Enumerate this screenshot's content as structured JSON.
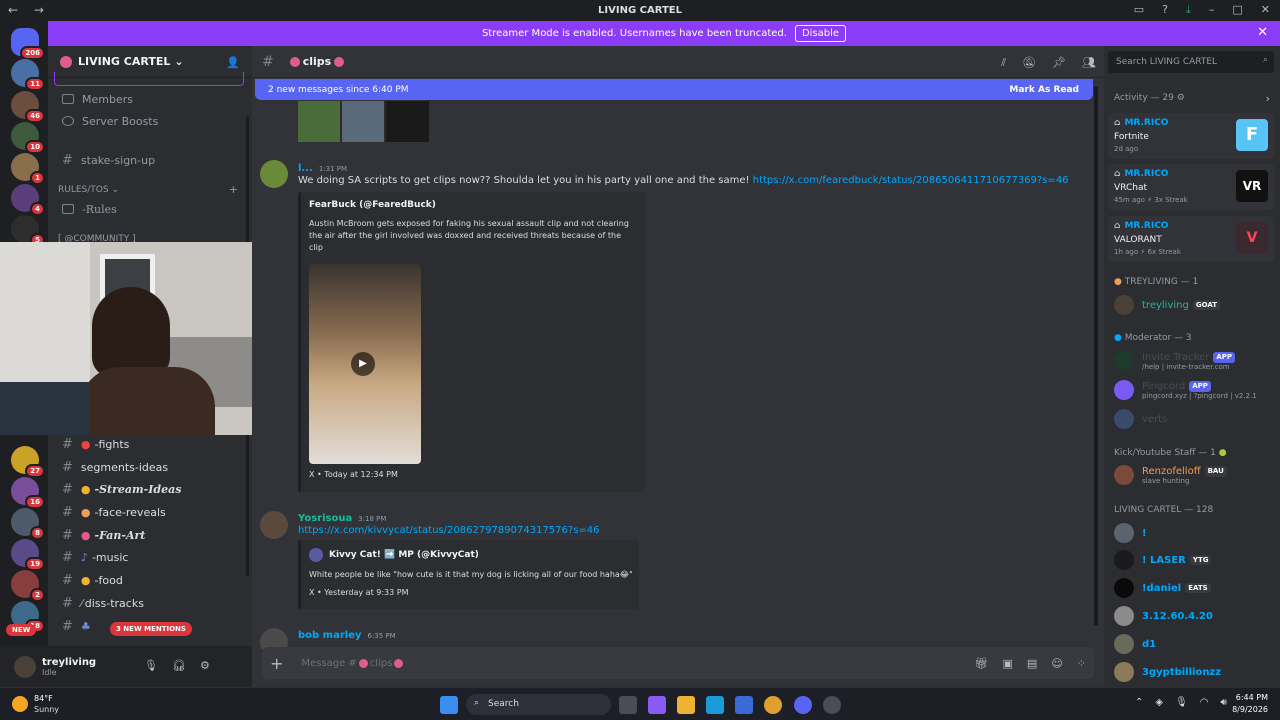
{
  "window": {
    "title": "LIVING CARTEL"
  },
  "banner": {
    "text": "Streamer Mode is enabled. Usernames have been truncated.",
    "button": "Disable"
  },
  "servers": {
    "home_badge": "206",
    "badges": [
      "11",
      "46",
      "10",
      "1",
      "4",
      "5",
      "27",
      "16",
      "8",
      "19",
      "2",
      "18"
    ],
    "new_label": "NEW"
  },
  "sidebar": {
    "server_name": "LIVING CARTEL",
    "items": [
      {
        "label": "Members"
      },
      {
        "label": "Server Boosts"
      }
    ],
    "channels_top": [
      {
        "label": "stake-sign-up"
      }
    ],
    "category_rules": "RULES/TOS",
    "rules_channel": "-Rules",
    "category_community": "[ @COMMUNITY ]",
    "channels": [
      {
        "label": "-fights"
      },
      {
        "label": "segments-ideas"
      },
      {
        "label": "-Stream-Ideas"
      },
      {
        "label": "-face-reveals"
      },
      {
        "label": "-Fan-Art"
      },
      {
        "label": "-music"
      },
      {
        "label": "-food"
      },
      {
        "label": "diss-tracks"
      }
    ],
    "mentions": "3 NEW MENTIONS"
  },
  "user": {
    "name": "treyliving",
    "status": "Idle"
  },
  "chat": {
    "channel": "clips",
    "new_messages": "2 new messages since 6:40 PM",
    "mark_read": "Mark As Read",
    "messages": [
      {
        "author": "l...",
        "time": "1:31 PM",
        "text": "We doing SA scripts to get clips now?? Shoulda let you in his party yall one and the same!",
        "link": "https://x.com/fearedbuck/status/2086506411710677369?s=46",
        "embed": {
          "author": "FearBuck (@FearedBuck)",
          "text": "Austin McBroom gets exposed for faking his sexual assault clip and not clearing the air after the girl involved was doxxed and received threats because of the clip",
          "footer": "X • Today at 12:34 PM"
        }
      },
      {
        "author": "Yosrisoua",
        "time": "3:18 PM",
        "link": "https://x.com/kivvycat/status/2086279789074317576?s=46",
        "embed": {
          "author": "Kivvy Cat! ➡️ MP (@KivvyCat)",
          "text": "White people be like \"how cute is it that my dog is licking all of our food haha😂\"",
          "footer": "X • Yesterday at 9:33 PM"
        }
      },
      {
        "author": "bob marley",
        "time": "6:35 PM"
      }
    ],
    "composer_placeholder": "Message #",
    "composer_channel": "clips"
  },
  "members": {
    "search_placeholder": "Search LIVING CARTEL",
    "activity_header": "Activity — 29",
    "activities": [
      {
        "user": "MR.RICO",
        "game": "Fortnite",
        "meta": "2d ago",
        "streak": ""
      },
      {
        "user": "MR.RICO",
        "game": "VRChat",
        "meta": "45m ago",
        "streak": "3x Streak"
      },
      {
        "user": "MR.RICO",
        "game": "VALORANT",
        "meta": "1h ago",
        "streak": "6x Streak"
      }
    ],
    "groups": [
      {
        "header": "TREYLIVING — 1",
        "members": [
          {
            "name": "treyliving",
            "tag": "GOAT",
            "sub": ""
          }
        ]
      },
      {
        "header": "Moderator — 3",
        "members": [
          {
            "name": "Invite Tracker",
            "tag": "APP",
            "sub": "/help | invite-tracker.com"
          },
          {
            "name": "Pingcord",
            "tag": "APP",
            "sub": "pingcord.xyz | ?pingcord | v2.2.1"
          },
          {
            "name": "verts",
            "tag": "",
            "sub": ""
          }
        ]
      },
      {
        "header": "Kick/Youtube Staff — 1",
        "members": [
          {
            "name": "Renzofelloff",
            "tag": "BAU",
            "sub": "slave hunting"
          }
        ]
      },
      {
        "header": "LIVING CARTEL — 128",
        "members": [
          {
            "name": "!",
            "tag": "",
            "sub": ""
          },
          {
            "name": "! LASER",
            "tag": "YTG",
            "sub": ""
          },
          {
            "name": "!daniel",
            "tag": "EATS",
            "sub": ""
          },
          {
            "name": "3.12.60.4.20",
            "tag": "",
            "sub": ""
          },
          {
            "name": "d1",
            "tag": "",
            "sub": ""
          },
          {
            "name": "3gyptbillionzz",
            "tag": "",
            "sub": ""
          }
        ]
      }
    ]
  },
  "taskbar": {
    "weather_temp": "84°F",
    "weather_desc": "Sunny",
    "search": "Search",
    "time": "6:44 PM",
    "date": "8/9/2026"
  }
}
